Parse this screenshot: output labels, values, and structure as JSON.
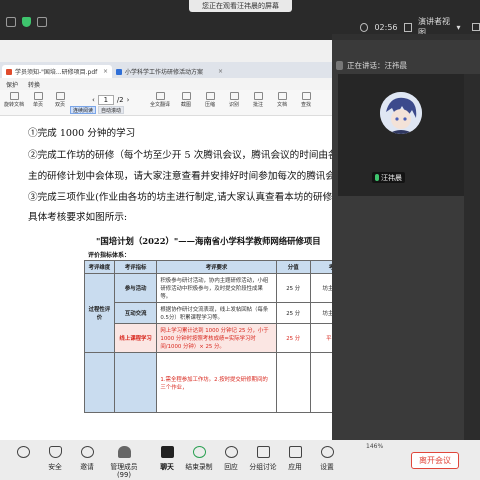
{
  "meeting": {
    "share_banner": "您正在观看汪祎晨的屏幕",
    "clock": "02:56",
    "view_mode": "演讲者视图",
    "leave_button": "离开会议"
  },
  "pdf_viewer": {
    "tabs": [
      {
        "label": "学员须知-\"国培...研修项目.pdf",
        "close": "×"
      },
      {
        "label": "小学科学工作坊研修活动方案",
        "close": "×"
      }
    ],
    "menu": [
      "保护",
      "转换"
    ],
    "tools": [
      "旋转文档",
      "单页",
      "双页",
      "连续阅读",
      "自动滚动",
      "全文翻译",
      "截图",
      "压缩",
      "识别",
      "批注",
      "文档",
      "查找"
    ],
    "page_current": "1",
    "page_total": "/2",
    "zoom": "146%"
  },
  "document": {
    "lines": [
      "①完成 1000 分钟的学习",
      "②完成工作坊的研修（每个坊至少开 5 次腾讯会议，腾讯会议的时间由各坊",
      "主的研修计划中会体现，请大家注意查看并安排好时间参加每次的腾讯会议）",
      "③完成三项作业(作业由各坊的坊主进行制定,请大家认真查看本坊的研修计划)",
      "具体考核要求如图所示:"
    ],
    "table_title": "\"国培计划（2022）\"——海南省小学科学教师网络研修项目",
    "table_subtitle": "评价指标体系：",
    "headers": [
      "考评维度",
      "考评指标",
      "考评要求",
      "分值",
      "考评人"
    ],
    "dimension": "过程性评价",
    "rows": [
      {
        "indicator": "参与活动",
        "requirement": "积极参与研讨活动，协内主题研修活动，小组研修活动中积极参与，及时提交阶段性成果等。",
        "score": "25 分",
        "assessor": "坊主/辅导员"
      },
      {
        "indicator": "互动交流",
        "requirement": "根据协作研讨交流表现，线上发帖回帖（每条0.5分）积累课程学习等。",
        "score": "25 分",
        "assessor": "坊主/辅导员"
      },
      {
        "indicator": "线上课程学习",
        "requirement": "网上学习累计达到 1000 分钟记 25 分，小于 1000 分钟时按照考核成绩=实际学习时间/1000 分钟）× 25 分。",
        "score": "25 分",
        "assessor": "平台统计"
      }
    ],
    "next_row": "1.需全程参加工作坊。2.按时提交研修期间的三个作业，"
  },
  "participant": {
    "header_name": "正在讲话：汪祎晨",
    "video_name": "汪祎晨"
  },
  "toolbar_buttons": [
    "安全",
    "邀请",
    "管理成员(99)",
    "聊天",
    "结束录制",
    "回应",
    "分组讨论",
    "应用",
    "设置"
  ],
  "colors": {
    "leave": "#e0463a",
    "table_header": "#c9dcef",
    "red_text": "#d8261c",
    "active_green": "#2aa052"
  }
}
